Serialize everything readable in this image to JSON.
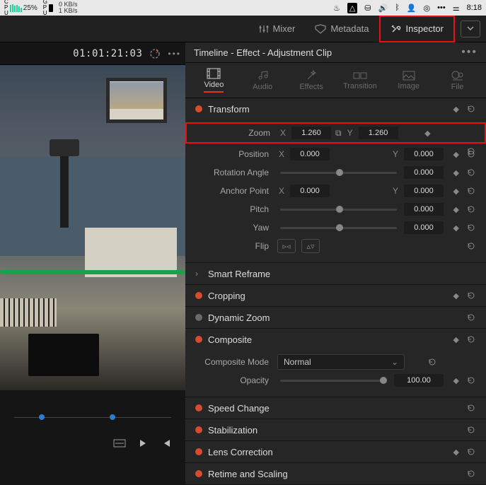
{
  "menubar": {
    "cpu_pct": "25%",
    "net_up": "0 KB/s",
    "net_down": "1 KB/s",
    "time": "8:18"
  },
  "top_tabs": {
    "mixer": "Mixer",
    "metadata": "Metadata",
    "inspector": "Inspector"
  },
  "timecode": "01:01:21:03",
  "panel_title": "Timeline - Effect - Adjustment Clip",
  "subtabs": {
    "video": "Video",
    "audio": "Audio",
    "effects": "Effects",
    "transition": "Transition",
    "image": "Image",
    "file": "File"
  },
  "sections": {
    "transform": "Transform",
    "smart_reframe": "Smart Reframe",
    "cropping": "Cropping",
    "dynamic_zoom": "Dynamic Zoom",
    "composite": "Composite",
    "speed_change": "Speed Change",
    "stabilization": "Stabilization",
    "lens_correction": "Lens Correction",
    "retime": "Retime and Scaling"
  },
  "transform": {
    "zoom_label": "Zoom",
    "position_label": "Position",
    "rotation_label": "Rotation Angle",
    "anchor_label": "Anchor Point",
    "pitch_label": "Pitch",
    "yaw_label": "Yaw",
    "flip_label": "Flip",
    "x": "X",
    "y": "Y",
    "zoom_x": "1.260",
    "zoom_y": "1.260",
    "pos_x": "0.000",
    "pos_y": "0.000",
    "rotation": "0.000",
    "anchor_x": "0.000",
    "anchor_y": "0.000",
    "pitch": "0.000",
    "yaw": "0.000"
  },
  "composite": {
    "mode_label": "Composite Mode",
    "mode_value": "Normal",
    "opacity_label": "Opacity",
    "opacity_value": "100.00"
  }
}
